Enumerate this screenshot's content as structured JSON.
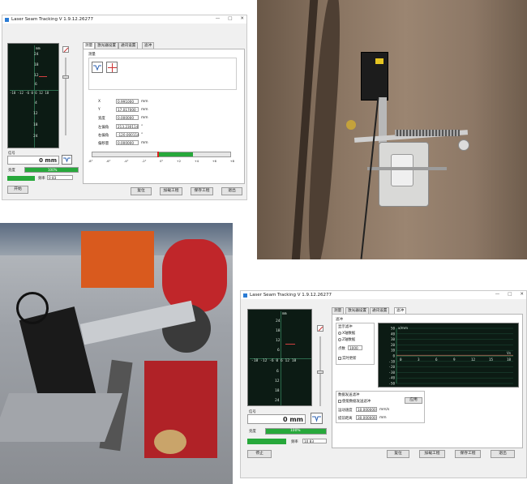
{
  "window1": {
    "title": "Laser Seam Tracking V 1.9.12.26277",
    "tabs": [
      "测量",
      "激光器设置",
      "通讯设置",
      "滤冲"
    ],
    "group_title": "测量",
    "y_ticks": [
      "24",
      "18",
      "12",
      "6",
      "4",
      "12",
      "18",
      "24"
    ],
    "x_ticks": "-18 -12 -6  0  6  12 18",
    "axis_unit": "mm",
    "fields": [
      {
        "label": "X",
        "value": "0.991000",
        "unit": "mm"
      },
      {
        "label": "Y",
        "value": "17.017000",
        "unit": "mm"
      },
      {
        "label": "宽度",
        "value": "0.000000",
        "unit": "mm"
      },
      {
        "label": "左偏角",
        "value": "213.230114",
        "unit": "°"
      },
      {
        "label": "右偏角",
        "value": "-120.000114",
        "unit": "°"
      },
      {
        "label": "偏移量",
        "value": "0.000000",
        "unit": "mm"
      }
    ],
    "scale_ticks": [
      "-8°",
      "-6°",
      "-4°",
      "-2°",
      "0°",
      "+2",
      "+4",
      "+6",
      "+8"
    ],
    "status_label": "信号",
    "reading": "0 mm",
    "row1_label": "亮度",
    "row1_pct": "100%",
    "row2_label": "频率",
    "row2_val": "0  83",
    "buttons": {
      "start": "开始",
      "reset": "复位",
      "load": "加载工程",
      "save": "保存工程",
      "exit": "退出"
    }
  },
  "window2": {
    "title": "Laser Seam Tracking V 1.9.12.26277",
    "tabs": [
      "测量",
      "激光器设置",
      "通讯设置",
      "滤冲"
    ],
    "group_title": "滤冲",
    "display_group": "显示滤冲",
    "radio1": "X轴数据",
    "radio2": "Z轴数据",
    "points_label": "点数",
    "points_value": "1000",
    "realtime_label": "实时更新",
    "chart_unit": "x/mm",
    "chart_y_ticks": [
      "50",
      "40",
      "30",
      "20",
      "10",
      "0",
      "-10",
      "-20",
      "-30",
      "-40",
      "-50"
    ],
    "chart_x_ticks": [
      "0",
      "3",
      "6",
      "9",
      "12",
      "15",
      "18"
    ],
    "chart_x_unit": "Vs",
    "send_group": "数据发送滤冲",
    "send_check": "使能数据发送滤冲",
    "apply_btn": "应用",
    "speed_label": "运动速度",
    "speed_value": "10.000000",
    "speed_unit": "mm/s",
    "dist_label": "提前距离",
    "dist_value": "30.000000",
    "dist_unit": "mm",
    "y_ticks": [
      "24",
      "18",
      "12",
      "6",
      "6",
      "12",
      "18",
      "24"
    ],
    "x_ticks": "-18 -12 -6  0  6  12 18",
    "axis_unit": "mm",
    "status_label": "信号",
    "reading": "0 mm",
    "row1_label": "亮度",
    "row1_pct": "100%",
    "row2_label": "频率",
    "row2_val": "10  83",
    "buttons": {
      "stop": "停止",
      "reset": "复位",
      "load": "加载工程",
      "save": "保存工程",
      "exit": "退出"
    }
  },
  "colors": {
    "accent_green": "#27a83b",
    "plot_bg": "#0c1b14",
    "robot_red": "#c0262a",
    "laser_orange": "#e0601c"
  }
}
